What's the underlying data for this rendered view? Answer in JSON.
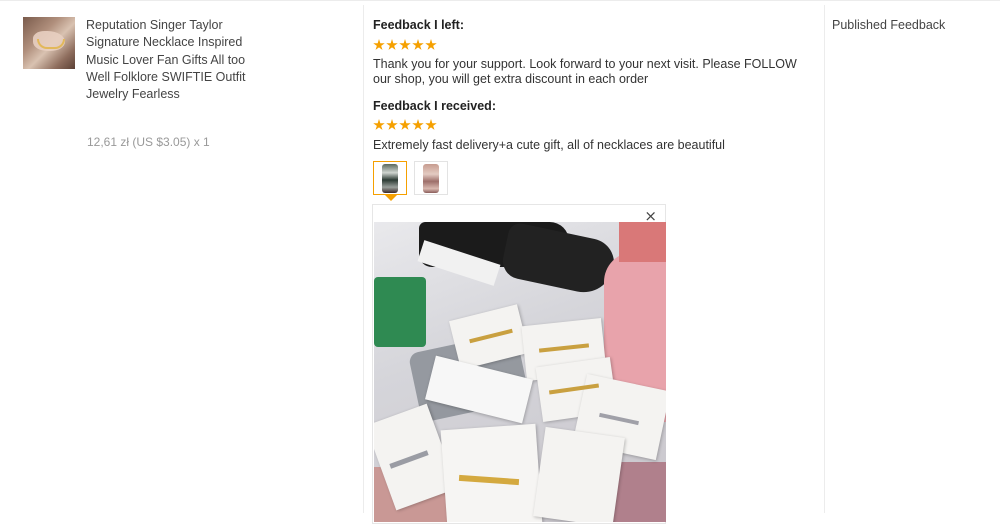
{
  "product": {
    "title": "Reputation Singer Taylor Signature Necklace Inspired Music Lover Fan Gifts All too Well Folklore SWIFTIE Outfit Jewelry Fearless",
    "price": "12,61 zł (US $3.05) x 1"
  },
  "feedback_left": {
    "heading": "Feedback I left:",
    "rating": 5,
    "text": "Thank you for your support. Look forward to your next visit. Please FOLLOW our shop, you will get extra discount in each order"
  },
  "feedback_received": {
    "heading": "Feedback I received:",
    "rating": 5,
    "text": "Extremely fast delivery+a cute gift, all of necklaces are beautiful",
    "photo_count": 2,
    "selected_photo": 1
  },
  "viewer": {
    "close_icon": "×"
  },
  "status": "Published Feedback",
  "colors": {
    "star": "#f5a000",
    "border": "#ececec"
  }
}
